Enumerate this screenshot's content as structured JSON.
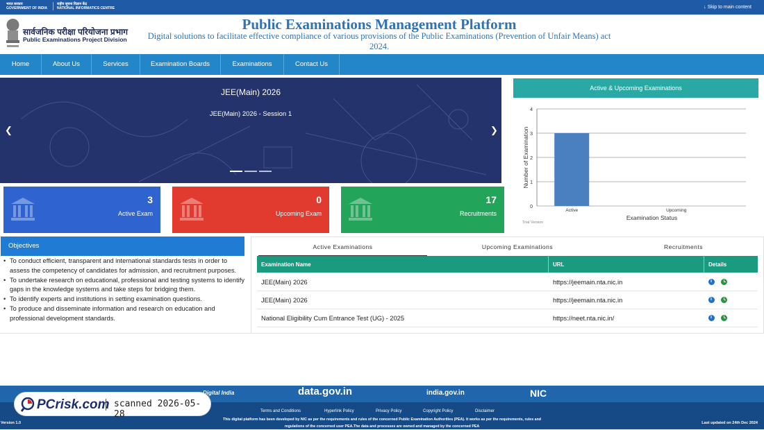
{
  "topbar": {
    "gov_hindi": "भारत सरकार",
    "gov_english": "GOVERNMENT OF INDIA",
    "nic_hindi": "राष्ट्रीय सूचना विज्ञान केंद्र",
    "nic_english": "NATIONAL INFORMATICS CENTRE",
    "skip_link": "Skip to main content"
  },
  "header": {
    "division_hindi": "सार्वजनिक परीक्षा परियोजना प्रभाग",
    "division_english": "Public Examinations Project Division",
    "title": "Public Examinations Management Platform",
    "subtitle": "Digital solutions to facilitate effective compliance of various provisions of the Public Examinations (Prevention of Unfair Means) act 2024."
  },
  "nav": {
    "items": [
      {
        "label": "Home"
      },
      {
        "label": "About Us"
      },
      {
        "label": "Services"
      },
      {
        "label": "Examination Boards"
      },
      {
        "label": "Examinations"
      },
      {
        "label": "Contact Us"
      }
    ]
  },
  "slider": {
    "title": "JEE(Main) 2026",
    "subtitle": "JEE(Main) 2026 - Session 1",
    "prev_icon": "chevron-left-icon",
    "next_icon": "chevron-right-icon",
    "slide_count": 3,
    "active_slide": 1
  },
  "stats": [
    {
      "value": "3",
      "label": "Active Exam",
      "color": "#2f63cf",
      "icon": "building-icon"
    },
    {
      "value": "0",
      "label": "Upcoming Exam",
      "color": "#e03b2e",
      "icon": "building-icon"
    },
    {
      "value": "17",
      "label": "Recruitments",
      "color": "#22a45a",
      "icon": "building-icon"
    }
  ],
  "chart_panel": {
    "heading": "Active & Upcoming Examinations",
    "trial_note": "Trial Version"
  },
  "chart_data": {
    "type": "bar",
    "categories": [
      "Active",
      "Upcoming"
    ],
    "values": [
      3,
      0
    ],
    "title": "",
    "xlabel": "Examination Status",
    "ylabel": "Number of Examination",
    "ylim": [
      0,
      4
    ],
    "yticks": [
      0,
      1,
      2,
      3,
      4
    ],
    "grid": true,
    "bar_color": "#4a7fc0"
  },
  "objectives": {
    "heading": "Objectives",
    "items": [
      "To conduct efficient, transparent and international standards tests in order to assess the competency of candidates for admission, and recruitment purposes.",
      "To undertake research on educational, professional and testing systems to identify gaps in the knowledge systems and take steps for bridging them.",
      "To identify experts and institutions in setting examination questions.",
      "To produce and disseminate information and research on education and professional development standards."
    ]
  },
  "exam_tabs": {
    "tabs": [
      {
        "label": "Active Examinations",
        "active": true
      },
      {
        "label": "Upcoming Examinations",
        "active": false
      },
      {
        "label": "Recruitments",
        "active": false
      }
    ],
    "columns": [
      "Examination Name",
      "URL",
      "Details"
    ],
    "rows": [
      {
        "name": "JEE(Main) 2026",
        "url": "https://jeemain.nta.nic.in"
      },
      {
        "name": "JEE(Main) 2026",
        "url": "https://jeemain.nta.nic.in"
      },
      {
        "name": "National Eligibility Cum Entrance Test (UG) - 2025",
        "url": "https://neet.nta.nic.in/"
      }
    ],
    "colors": {
      "header": "#1a9a7f",
      "info": "#1f6fc4",
      "clock": "#1e9a3a"
    }
  },
  "footer": {
    "logos": [
      "Digital India",
      "data.gov.in",
      "india.gov.in",
      "NIC"
    ],
    "links": [
      "Terms and Conditions",
      "Hyperlink Policy",
      "Privacy Policy",
      "Copyright Policy",
      "Disclaimer"
    ],
    "version": "Version 1.0",
    "last_updated": "Last updated on 24th Dec 2024",
    "dev_note_1": "This digital platform has been developed by NIC as per the requirements and rules of the concerned Public Examination Authorities (PEA). It works as per the requirements, rules and",
    "dev_note_2": "regulations of the concerned user PEA.The data and processes are owned and managed by the concerned PEA"
  },
  "watermark": {
    "brand": "PCrisk.com",
    "scan_text": "scanned 2026-05-28"
  }
}
